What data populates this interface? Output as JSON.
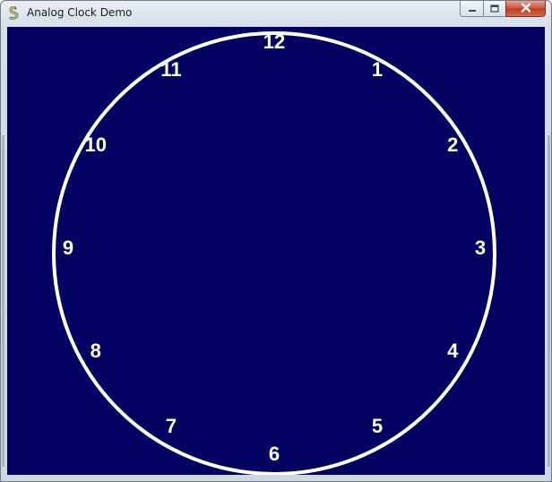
{
  "window": {
    "title": "Analog Clock Demo",
    "app_icon": "snake-icon",
    "controls": {
      "minimize_icon": "minimize-icon",
      "maximize_icon": "maximize-icon",
      "close_icon": "close-icon"
    }
  },
  "clock": {
    "numbers": [
      "12",
      "1",
      "2",
      "3",
      "4",
      "5",
      "6",
      "7",
      "8",
      "9",
      "10",
      "11"
    ],
    "colors": {
      "face": "#020261",
      "ring": "#ffffff",
      "numbers": "#ffffff"
    }
  }
}
